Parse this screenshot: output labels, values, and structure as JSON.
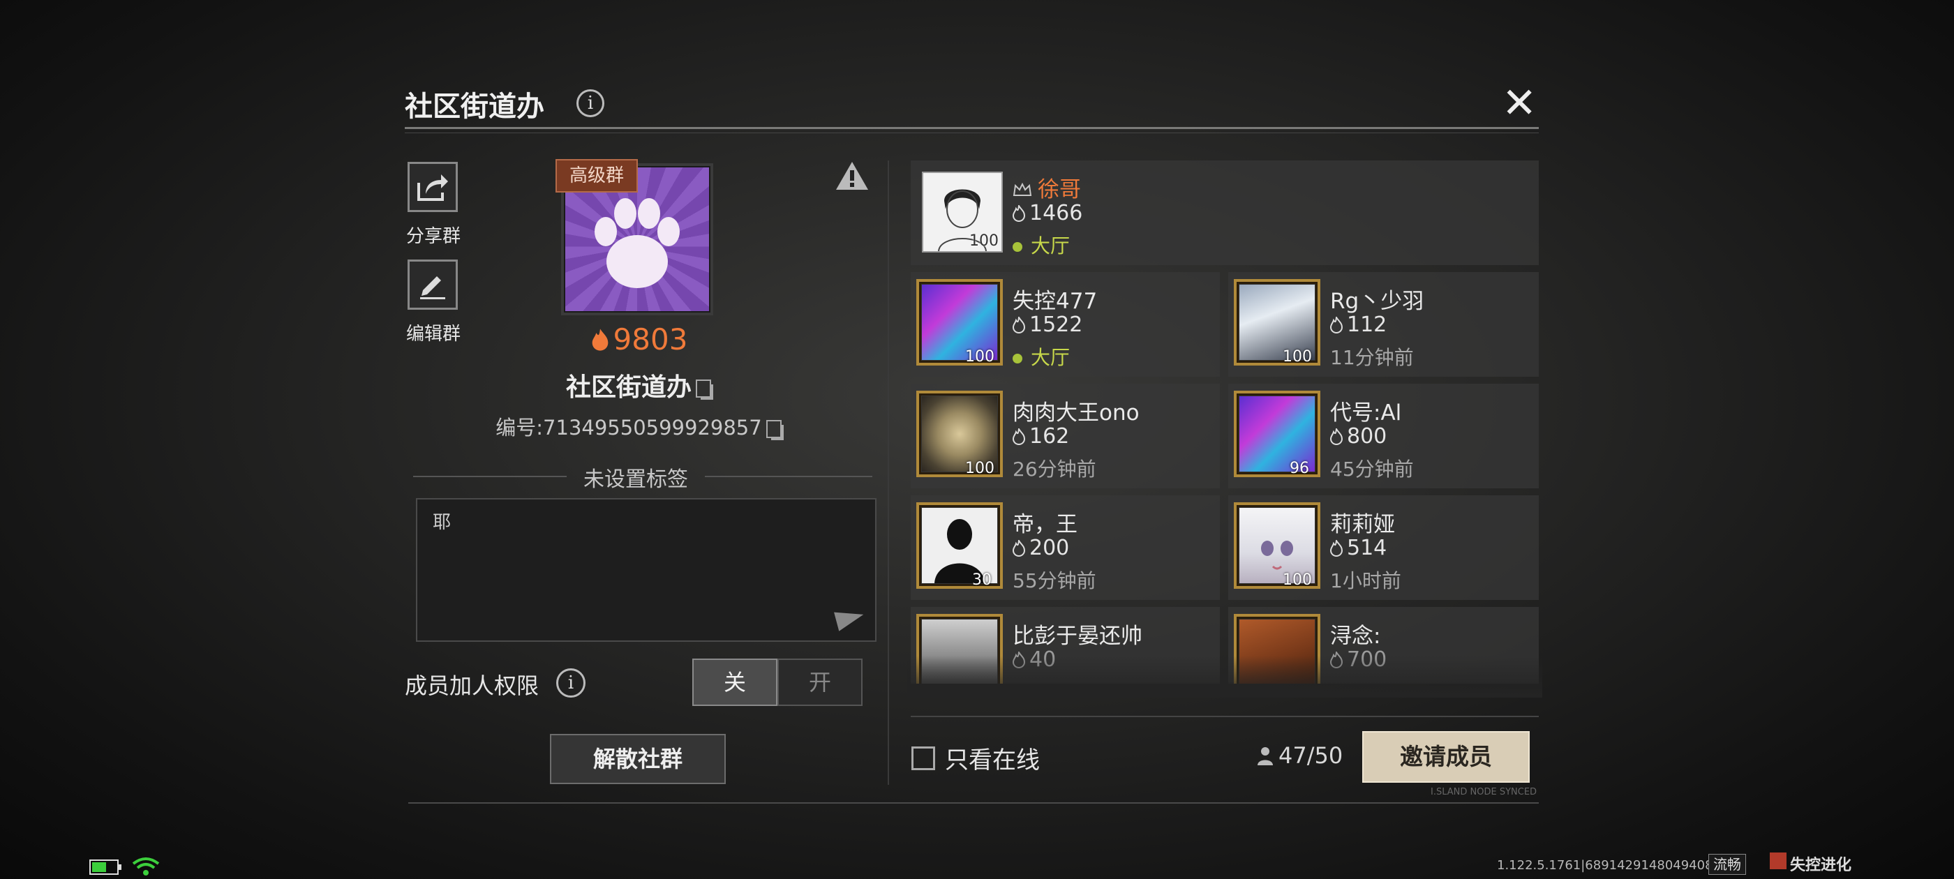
{
  "header": {
    "title": "社区街道办",
    "info_icon": "i",
    "close_icon": "✕"
  },
  "sidebar": {
    "share_label": "分享群",
    "edit_label": "编辑群"
  },
  "group": {
    "badge": "高级群",
    "score": "9803",
    "name": "社区街道办",
    "id_text": "编号:71349550599929857",
    "tag_placeholder": "未设置标签",
    "description": "耶"
  },
  "permission": {
    "label": "成员加人权限",
    "off_label": "关",
    "on_label": "开",
    "selected": "关"
  },
  "disband_label": "解散社群",
  "members": [
    {
      "name": "徐哥",
      "score": "1466",
      "status": "大厅",
      "online": true,
      "leader": true,
      "level": "100"
    },
    {
      "name": "失控477",
      "score": "1522",
      "status": "大厅",
      "online": true,
      "level": "100"
    },
    {
      "name": "Rg丶少羽",
      "score": "112",
      "status": "11分钟前",
      "online": false,
      "level": "100"
    },
    {
      "name": "肉肉大王ono",
      "score": "162",
      "status": "26分钟前",
      "online": false,
      "level": "100"
    },
    {
      "name": "代号:Al",
      "score": "800",
      "status": "45分钟前",
      "online": false,
      "level": "96"
    },
    {
      "name": "帝，王",
      "score": "200",
      "status": "55分钟前",
      "online": false,
      "level": "30"
    },
    {
      "name": "莉莉娅",
      "score": "514",
      "status": "1小时前",
      "online": false,
      "level": "100"
    },
    {
      "name": "比彭于晏还帅",
      "score": "40",
      "status": "",
      "online": false,
      "level": ""
    },
    {
      "name": "浔念:",
      "score": "700",
      "status": "",
      "online": false,
      "level": ""
    }
  ],
  "footer": {
    "online_only_label": "只看在线",
    "member_count": "47/50",
    "invite_label": "邀请成员"
  },
  "decor": {
    "island_text": "I.SLAND NODE SYNCED"
  },
  "statusbar": {
    "version": "1.122.5.1761|68914291480494082",
    "smooth_label": "流畅",
    "logo_text": "失控进化"
  },
  "colors": {
    "accent_orange": "#f07a3a",
    "online_green": "#c7d84a",
    "invite_bg": "#d9cdb6",
    "badge_bg": "#7a3a22"
  }
}
